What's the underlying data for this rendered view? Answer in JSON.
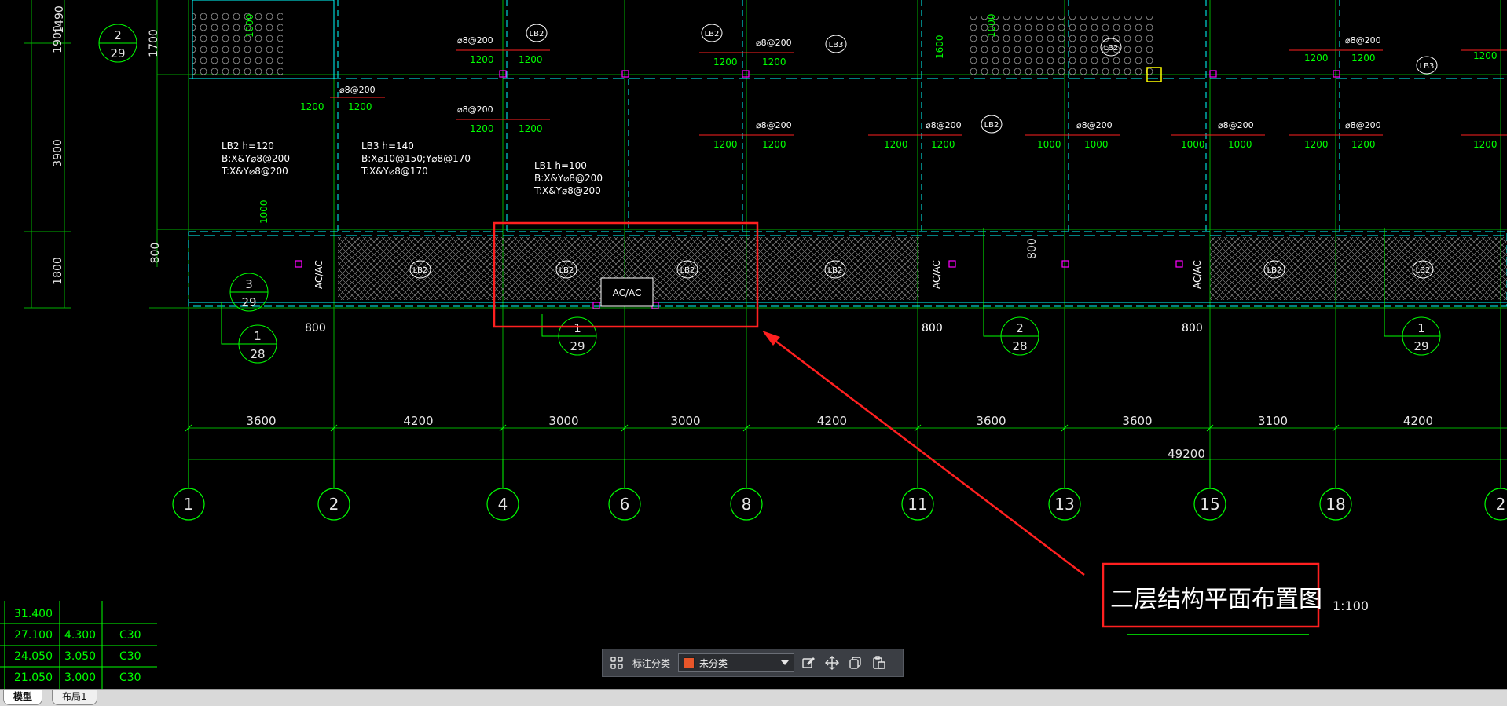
{
  "drawing": {
    "title": "二层结构平面布置图",
    "scale": "1:100",
    "total_dimension": "49200",
    "dim_labels": [
      "3600",
      "4200",
      "3000",
      "3000",
      "4200",
      "3600",
      "3600",
      "3100",
      "4200"
    ],
    "axes": [
      "1",
      "2",
      "4",
      "6",
      "8",
      "11",
      "13",
      "15",
      "18",
      "2"
    ],
    "left_dims": [
      "1490",
      "1900",
      "3900",
      "1800",
      "1700",
      "800"
    ],
    "detail_marks": {
      "a": {
        "num": "2",
        "den": "29"
      },
      "b": {
        "num": "3",
        "den": "29"
      },
      "c": {
        "num": "1",
        "den": "28"
      },
      "d": {
        "num": "1",
        "den": "29"
      },
      "e": {
        "num": "2",
        "den": "28"
      },
      "f": {
        "num": "1",
        "den": "29"
      }
    },
    "slab_notes": {
      "lb2": [
        "LB2   h=120",
        "B:X&Y⌀8@200",
        "T:X&Y⌀8@200"
      ],
      "lb3": [
        "LB3   h=140",
        "B:X⌀10@150;Y⌀8@170",
        "T:X&Y⌀8@170"
      ],
      "lb1": [
        "LB1   h=100",
        "B:X&Y⌀8@200",
        "T:X&Y⌀8@200"
      ]
    },
    "slab_tags": {
      "lb2": "LB2",
      "lb3": "LB3"
    },
    "rebar_short": "⌀8@200",
    "small_dims": {
      "d1200": "1200",
      "d1000": "1000",
      "d800": "800",
      "d1600": "1600"
    },
    "ac_tag": "AC/AC"
  },
  "elevation_table": {
    "rows": [
      {
        "elev": "31.400",
        "height": "",
        "grade": ""
      },
      {
        "elev": "27.100",
        "height": "4.300",
        "grade": "C30"
      },
      {
        "elev": "24.050",
        "height": "3.050",
        "grade": "C30"
      },
      {
        "elev": "21.050",
        "height": "3.000",
        "grade": "C30"
      }
    ]
  },
  "toolbar": {
    "label": "标注分类",
    "selected": "未分类",
    "swatch_color": "#e8562a",
    "icons": [
      "grid-icon",
      "edit-icon",
      "move-icon",
      "copy-icon",
      "paste-icon"
    ]
  },
  "tabs": [
    {
      "label": "模型",
      "active": true
    },
    {
      "label": "布局1",
      "active": false
    }
  ],
  "colors": {
    "green": "#00ff00",
    "white": "#ffffff",
    "cyan": "#00ffff",
    "magenta": "#ff00ff",
    "red": "#ff2020",
    "yellow": "#ffff00",
    "background": "#000000"
  }
}
